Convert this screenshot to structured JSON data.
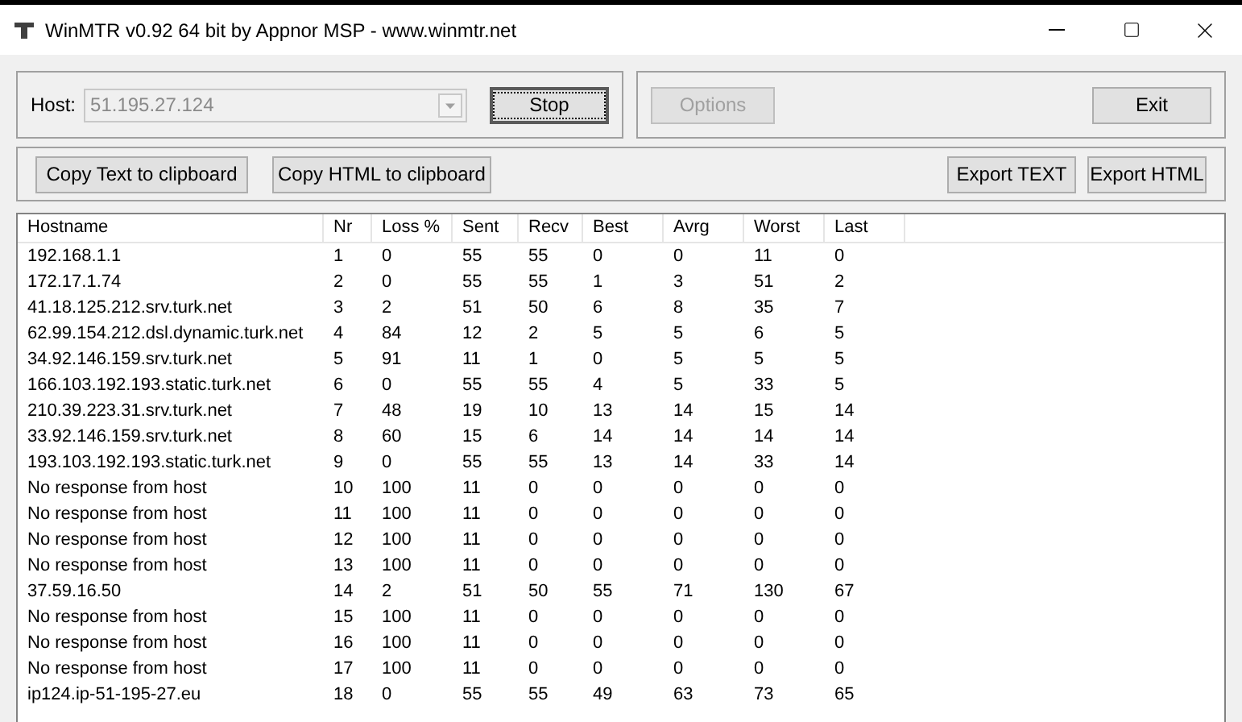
{
  "window": {
    "title": "WinMTR v0.92 64 bit by Appnor MSP - www.winmtr.net"
  },
  "host": {
    "label": "Host:",
    "value": "51.195.27.124",
    "disabled": true
  },
  "buttons": [
    {
      "label": "Stop",
      "focused": true,
      "disabled": false
    },
    {
      "label": "Options",
      "focused": false,
      "disabled": true
    },
    {
      "label": "Exit",
      "focused": false,
      "disabled": false
    }
  ],
  "export_buttons": [
    {
      "label": "Copy Text to clipboard"
    },
    {
      "label": "Copy HTML to clipboard"
    },
    {
      "label": "Export TEXT"
    },
    {
      "label": "Export HTML"
    }
  ],
  "table": {
    "columns": [
      "Hostname",
      "Nr",
      "Loss %",
      "Sent",
      "Recv",
      "Best",
      "Avrg",
      "Worst",
      "Last"
    ],
    "rows": [
      [
        "192.168.1.1",
        "1",
        "0",
        "55",
        "55",
        "0",
        "0",
        "11",
        "0"
      ],
      [
        "172.17.1.74",
        "2",
        "0",
        "55",
        "55",
        "1",
        "3",
        "51",
        "2"
      ],
      [
        "41.18.125.212.srv.turk.net",
        "3",
        "2",
        "51",
        "50",
        "6",
        "8",
        "35",
        "7"
      ],
      [
        "62.99.154.212.dsl.dynamic.turk.net",
        "4",
        "84",
        "12",
        "2",
        "5",
        "5",
        "6",
        "5"
      ],
      [
        "34.92.146.159.srv.turk.net",
        "5",
        "91",
        "11",
        "1",
        "0",
        "5",
        "5",
        "5"
      ],
      [
        "166.103.192.193.static.turk.net",
        "6",
        "0",
        "55",
        "55",
        "4",
        "5",
        "33",
        "5"
      ],
      [
        "210.39.223.31.srv.turk.net",
        "7",
        "48",
        "19",
        "10",
        "13",
        "14",
        "15",
        "14"
      ],
      [
        "33.92.146.159.srv.turk.net",
        "8",
        "60",
        "15",
        "6",
        "14",
        "14",
        "14",
        "14"
      ],
      [
        "193.103.192.193.static.turk.net",
        "9",
        "0",
        "55",
        "55",
        "13",
        "14",
        "33",
        "14"
      ],
      [
        "No response from host",
        "10",
        "100",
        "11",
        "0",
        "0",
        "0",
        "0",
        "0"
      ],
      [
        "No response from host",
        "11",
        "100",
        "11",
        "0",
        "0",
        "0",
        "0",
        "0"
      ],
      [
        "No response from host",
        "12",
        "100",
        "11",
        "0",
        "0",
        "0",
        "0",
        "0"
      ],
      [
        "No response from host",
        "13",
        "100",
        "11",
        "0",
        "0",
        "0",
        "0",
        "0"
      ],
      [
        "37.59.16.50",
        "14",
        "2",
        "51",
        "50",
        "55",
        "71",
        "130",
        "67"
      ],
      [
        "No response from host",
        "15",
        "100",
        "11",
        "0",
        "0",
        "0",
        "0",
        "0"
      ],
      [
        "No response from host",
        "16",
        "100",
        "11",
        "0",
        "0",
        "0",
        "0",
        "0"
      ],
      [
        "No response from host",
        "17",
        "100",
        "11",
        "0",
        "0",
        "0",
        "0",
        "0"
      ],
      [
        "ip124.ip-51-195-27.eu",
        "18",
        "0",
        "55",
        "55",
        "49",
        "63",
        "73",
        "65"
      ]
    ]
  }
}
